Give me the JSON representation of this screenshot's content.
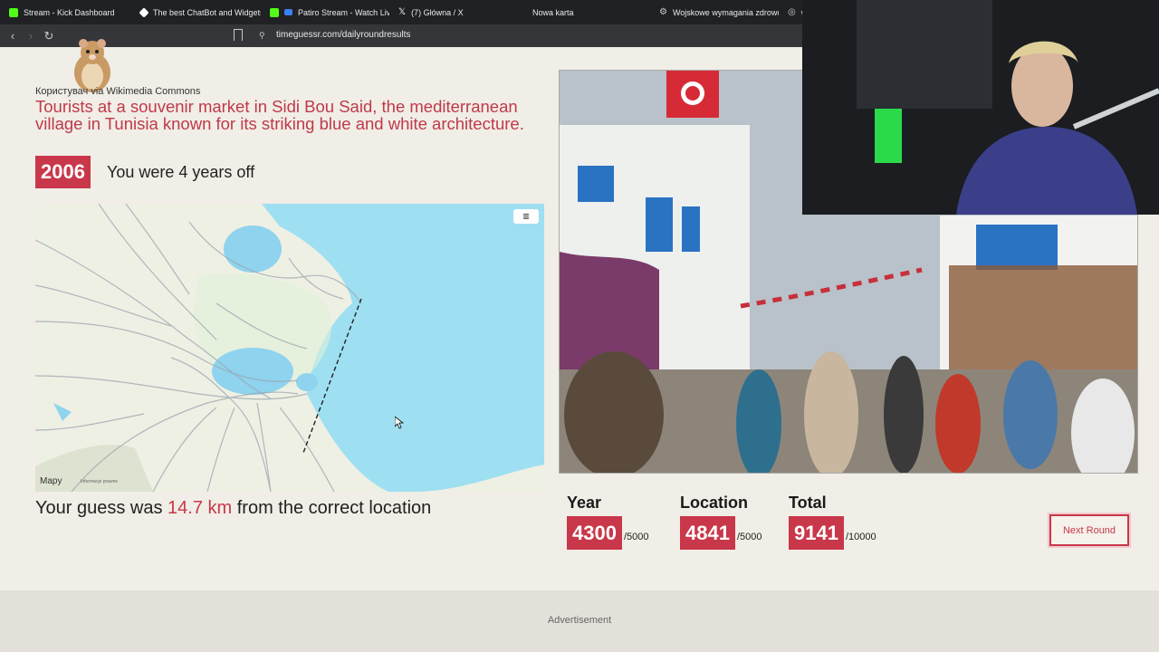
{
  "browser": {
    "tabs": [
      {
        "label": "Stream - Kick Dashboard",
        "color": "#53fc18"
      },
      {
        "label": "The best ChatBot and Widgets",
        "color": "#ffffff"
      },
      {
        "label": "Patiro Stream - Watch Live",
        "color": "#53fc18"
      },
      {
        "label": "(7) Główna / X",
        "color": "#ffffff"
      },
      {
        "label": "Nowa karta",
        "color": ""
      },
      {
        "label": "Wojskowe wymagania zdrowot",
        "color": "#ffffff"
      },
      {
        "label": "w",
        "color": "#ffffff"
      }
    ],
    "url": "timeguessr.com/dailyroundresults"
  },
  "result": {
    "credit": "Користувач via Wikimedia Commons",
    "description": "Tourists at a souvenir market in Sidi Bou Said, the mediterranean village in Tunisia known for its striking blue and white architecture.",
    "year": "2006",
    "year_off_text": "You were 4 years off",
    "distance_prefix": "Your guess was",
    "distance_value": "14.7 km",
    "distance_suffix": "from the correct location"
  },
  "map": {
    "logo": "Mapy",
    "info": "Informacje prawne"
  },
  "scores": [
    {
      "label": "Year",
      "value": "4300",
      "max": "/5000"
    },
    {
      "label": "Location",
      "value": "4841",
      "max": "/5000"
    },
    {
      "label": "Total",
      "value": "9141",
      "max": "/10000"
    }
  ],
  "next_button": "Next Round",
  "ad_label": "Advertisement",
  "colors": {
    "accent": "#c9374a",
    "page_bg": "#f0eee6",
    "sea": "#9edff2"
  }
}
